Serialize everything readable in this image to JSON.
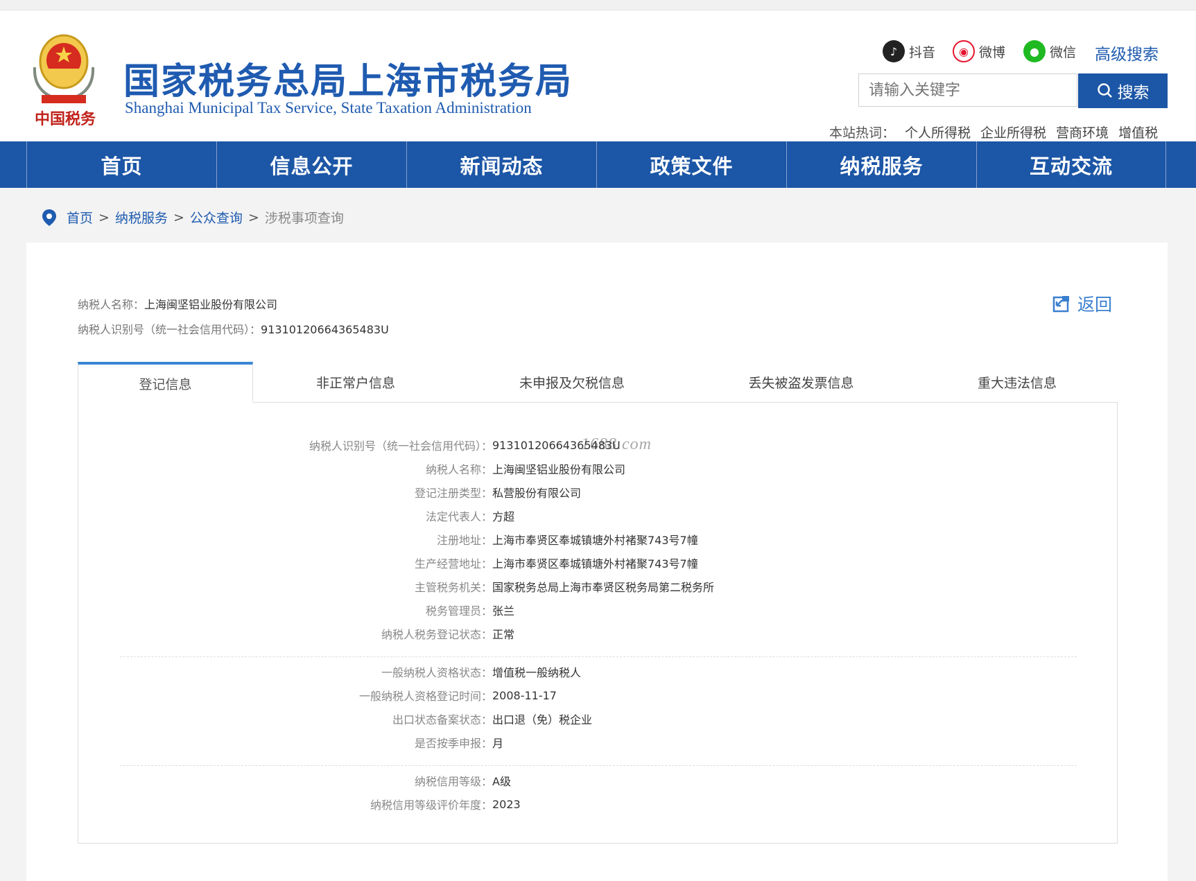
{
  "header": {
    "title": "国家税务总局上海市税务局",
    "subtitle": "Shanghai Municipal Tax Service, State Taxation Administration",
    "emblem_text": "中国税务",
    "social": [
      {
        "label": "抖音",
        "icon": "douyin-icon"
      },
      {
        "label": "微博",
        "icon": "weibo-icon"
      },
      {
        "label": "微信",
        "icon": "wechat-icon"
      }
    ],
    "advanced_search": "高级搜索",
    "search": {
      "placeholder": "请输入关键字",
      "button": "搜索"
    },
    "hotwords": {
      "label": "本站热词：",
      "items": [
        "个人所得税",
        "企业所得税",
        "营商环境",
        "增值税"
      ]
    }
  },
  "nav": [
    "首页",
    "信息公开",
    "新闻动态",
    "政策文件",
    "纳税服务",
    "互动交流"
  ],
  "breadcrumb": {
    "items": [
      "首页",
      "纳税服务",
      "公众查询"
    ],
    "current": "涉税事项查询",
    "separator": ">"
  },
  "taxpayer": {
    "name_label": "纳税人名称：",
    "name": "上海闽坚铝业股份有限公司",
    "id_label": "纳税人识别号（统一社会信用代码）：",
    "id": "91310120664365483U"
  },
  "back_label": "返回",
  "tabs": [
    "登记信息",
    "非正常户信息",
    "未申报及欠税信息",
    "丢失被盗发票信息",
    "重大违法信息"
  ],
  "active_tab": 0,
  "watermark": "1688.com",
  "registration": [
    {
      "label": "纳税人识别号（统一社会信用代码）：",
      "value": "91310120664365483U"
    },
    {
      "label": "纳税人名称：",
      "value": "上海闽坚铝业股份有限公司"
    },
    {
      "label": "登记注册类型：",
      "value": "私营股份有限公司"
    },
    {
      "label": "法定代表人：",
      "value": "方超"
    },
    {
      "label": "注册地址：",
      "value": "上海市奉贤区奉城镇塘外村褚聚743号7幢"
    },
    {
      "label": "生产经营地址：",
      "value": "上海市奉贤区奉城镇塘外村褚聚743号7幢"
    },
    {
      "label": "主管税务机关：",
      "value": "国家税务总局上海市奉贤区税务局第二税务所"
    },
    {
      "label": "税务管理员：",
      "value": "张兰"
    },
    {
      "label": "纳税人税务登记状态：",
      "value": "正常"
    }
  ],
  "qualification": [
    {
      "label": "一般纳税人资格状态：",
      "value": "增值税一般纳税人"
    },
    {
      "label": "一般纳税人资格登记时间：",
      "value": "2008-11-17"
    },
    {
      "label": "出口状态备案状态：",
      "value": "出口退（免）税企业"
    },
    {
      "label": "是否按季申报：",
      "value": "月"
    }
  ],
  "credit": [
    {
      "label": "纳税信用等级：",
      "value": "A级"
    },
    {
      "label": "纳税信用等级评价年度：",
      "value": "2023"
    }
  ],
  "colors": {
    "brand": "#1c56a6",
    "title": "#1f5bb0",
    "tab_active": "#3a86d6"
  }
}
